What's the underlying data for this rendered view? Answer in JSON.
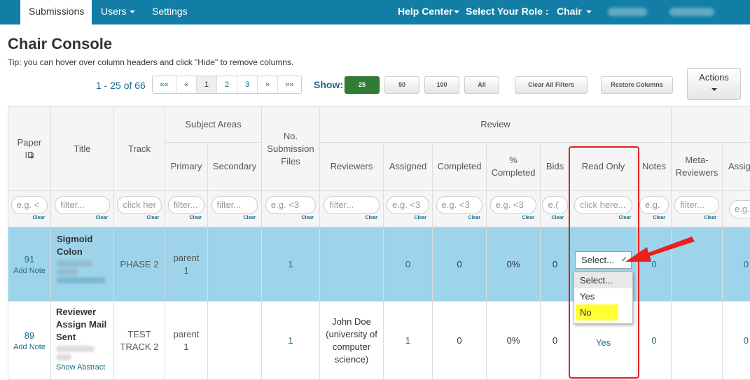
{
  "nav": {
    "tabs": [
      "Submissions",
      "Users",
      "Settings"
    ],
    "help_center": "Help Center",
    "role_label": "Select Your Role :",
    "role_value": "Chair"
  },
  "header": {
    "title": "Chair Console",
    "tip": "Tip: you can hover over column headers and click \"Hide\" to remove columns."
  },
  "pagination": {
    "count": "1 - 25 of 66",
    "pages": [
      "««",
      "«",
      "1",
      "2",
      "3",
      "»",
      "»»"
    ],
    "current": "1"
  },
  "show": {
    "label": "Show:",
    "options": [
      "25",
      "50",
      "100",
      "All"
    ],
    "selected": "25"
  },
  "toolbar": {
    "clear_filters": "Clear All Filters",
    "restore_columns": "Restore Columns",
    "actions": "Actions"
  },
  "table": {
    "group_headers": {
      "subject_areas": "Subject Areas",
      "review": "Review"
    },
    "headers": {
      "paper_id": "Paper ID",
      "title": "Title",
      "track": "Track",
      "primary": "Primary",
      "secondary": "Secondary",
      "files": "No. Submission Files",
      "reviewers": "Reviewers",
      "assigned": "Assigned",
      "completed": "Completed",
      "pct_completed": "% Completed",
      "bids": "Bids",
      "read_only": "Read Only",
      "notes": "Notes",
      "meta_reviewers": "Meta-Reviewers",
      "assigned2": "Assig"
    },
    "filters": {
      "paper_id": "e.g. <",
      "title": "filter...",
      "track": "click her",
      "primary": "filter...",
      "secondary": "filter...",
      "files": "e.g. <3",
      "reviewers": "filter...",
      "assigned": "e.g. <3",
      "completed": "e.g. <3",
      "pct_completed": "e.g. <3",
      "bids": "e.(",
      "read_only": "click here...",
      "notes": "e.g.",
      "meta_reviewers": "filter...",
      "assigned2": "e.g.",
      "clear": "Clear"
    },
    "rows": [
      {
        "id": "91",
        "add_note": "Add Note",
        "title": "Sigmoid Colon",
        "track": "PHASE 2",
        "primary": "parent 1",
        "secondary": "",
        "files": "1",
        "reviewers": "",
        "assigned": "0",
        "completed": "0",
        "pct": "0%",
        "bids": "0",
        "read_only": "Select...",
        "notes": "0",
        "meta_reviewers": "",
        "assigned2": "0"
      },
      {
        "id": "89",
        "add_note": "Add Note",
        "title": "Reviewer Assign Mail Sent",
        "show_abstract": "Show Abstract",
        "track": "TEST TRACK 2",
        "primary": "parent 1",
        "secondary": "",
        "files": "1",
        "reviewers": "John Doe (university of computer science)",
        "assigned": "1",
        "completed": "0",
        "pct": "0%",
        "bids": "0",
        "read_only": "Yes",
        "notes": "0",
        "meta_reviewers": "",
        "assigned2": "0"
      }
    ]
  },
  "dropdown": {
    "options": [
      "Select...",
      "Yes",
      "No"
    ],
    "highlighted": "No"
  },
  "colors": {
    "navbar": "#127ea6",
    "selected_row": "#9dd4eb",
    "annotation": "#e02020",
    "highlight": "#ffff33"
  }
}
